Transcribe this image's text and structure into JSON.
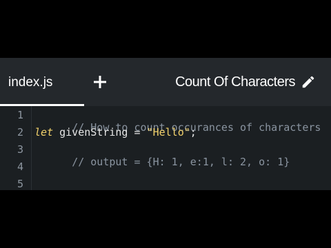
{
  "tabs": [
    {
      "label": "index.js",
      "active": true
    }
  ],
  "title": "Count Of Characters",
  "icons": {
    "add": "plus-icon",
    "edit": "pencil-icon"
  },
  "colors": {
    "background": "#1b1f22",
    "topbar": "#24282c",
    "keyword": "#f2d16b",
    "comment": "#8a94a0"
  },
  "editor": {
    "line_numbers": [
      "1",
      "2",
      "3",
      "4",
      "5"
    ],
    "lines": [
      {
        "comment": "// How to count occurances of characters"
      },
      {
        "keyword": "let",
        "ident": " givenString ",
        "op": "= ",
        "string": "\"Hello\"",
        "end": ";"
      },
      {
        "comment": "// output = {H: 1, e:1, l: 2, o: 1}"
      },
      {},
      {}
    ]
  }
}
